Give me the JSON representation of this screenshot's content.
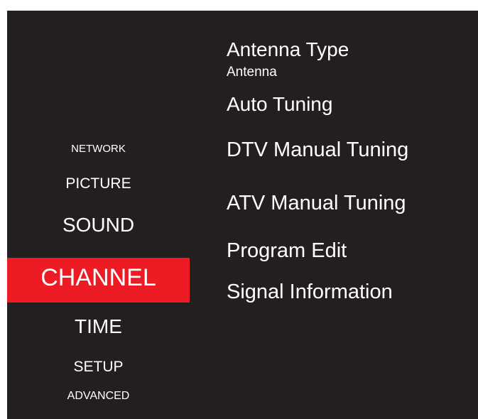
{
  "colors": {
    "panel_background": "#231f20",
    "selected_background": "#ed1c24",
    "text": "#ffffff"
  },
  "left_menu": {
    "items": [
      {
        "label": "NETWORK",
        "selected": false
      },
      {
        "label": "PICTURE",
        "selected": false
      },
      {
        "label": "SOUND",
        "selected": false
      },
      {
        "label": "CHANNEL",
        "selected": true
      },
      {
        "label": "TIME",
        "selected": false
      },
      {
        "label": "SETUP",
        "selected": false
      },
      {
        "label": "ADVANCED",
        "selected": false
      }
    ]
  },
  "channel_menu": {
    "antenna_type": {
      "label": "Antenna Type",
      "value": "Antenna"
    },
    "auto_tuning": "Auto Tuning",
    "dtv_manual_tuning": "DTV Manual Tuning",
    "atv_manual_tuning": "ATV Manual Tuning",
    "program_edit": "Program Edit",
    "signal_information": "Signal Information"
  }
}
